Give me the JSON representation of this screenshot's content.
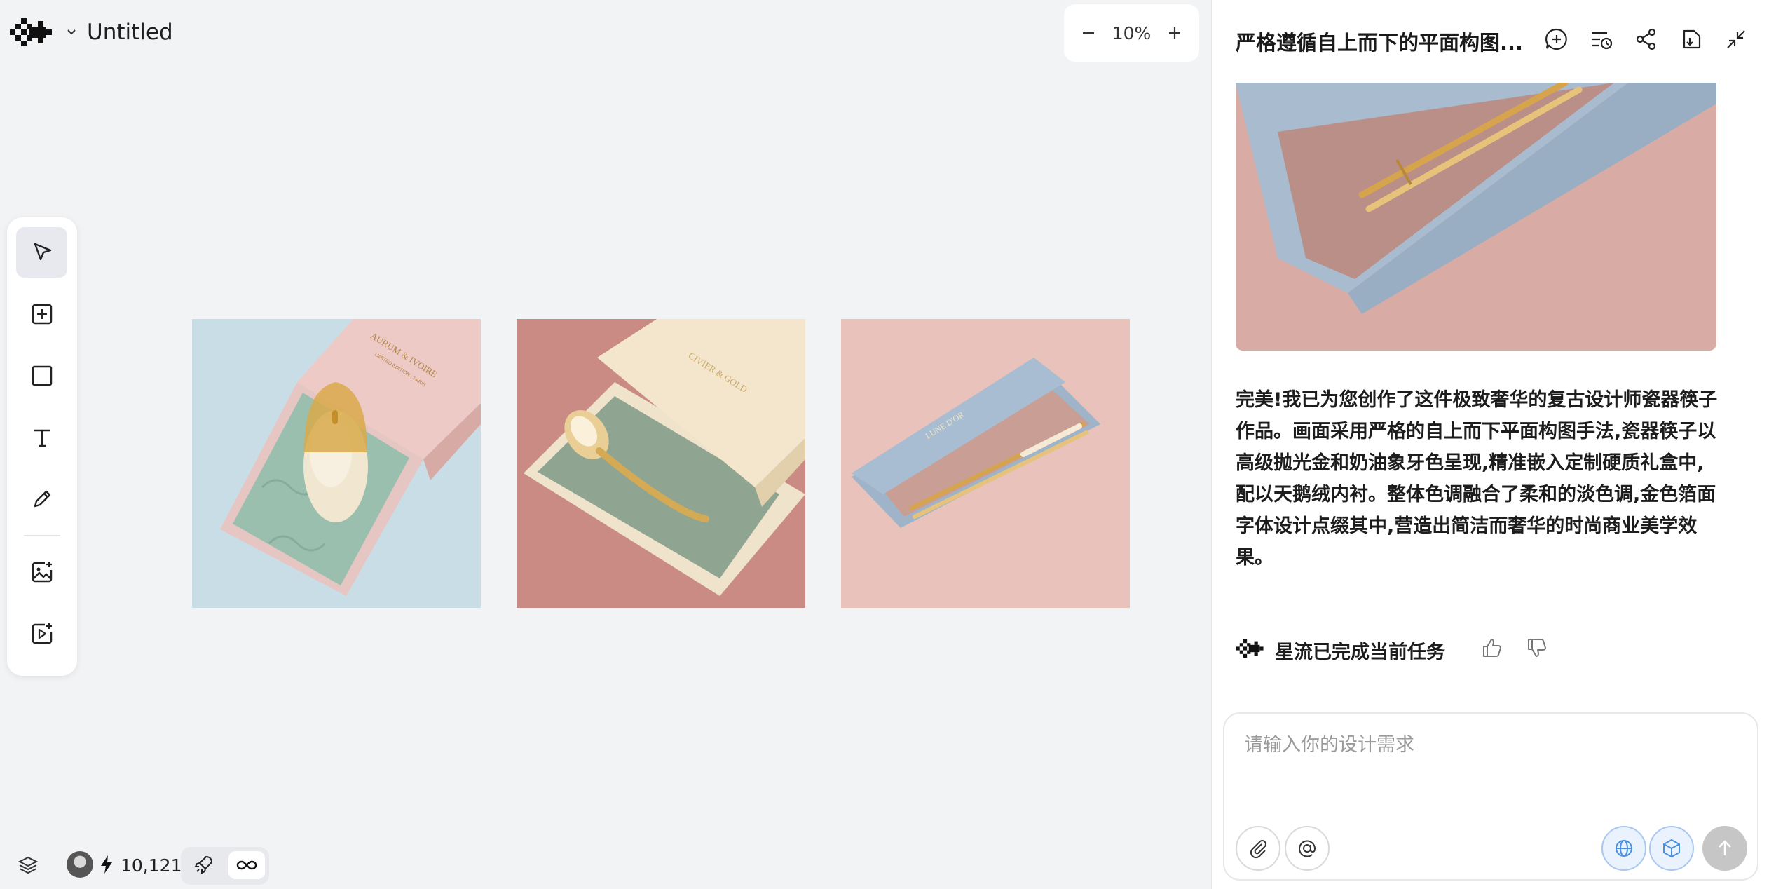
{
  "project": {
    "name": "Untitled"
  },
  "zoom": {
    "level": "10%"
  },
  "toolbar": {
    "tools": [
      "select",
      "add-frame",
      "rectangle",
      "text",
      "pen",
      "generate-image",
      "generate-video"
    ],
    "active": "select"
  },
  "artboards": [
    {
      "product": "mouse",
      "box_text_line1": "AURUM & IVOIRE",
      "box_text_line2": "LIMITED EDITION · PARIS",
      "background": "#c9dde6"
    },
    {
      "product": "spoon",
      "box_text_line1": "CIVIER & GOLD",
      "background": "#c98b83"
    },
    {
      "product": "chopsticks",
      "box_text_line1": "LUNE D'OR",
      "background": "#e8c2bb"
    }
  ],
  "footer": {
    "credits": "10,121"
  },
  "chat": {
    "title": "严格遵循自上而下的平面构图...",
    "message": "完美!我已为您创作了这件极致奢华的复古设计师瓷器筷子作品。画面采用严格的自上而下平面构图手法,瓷器筷子以高级抛光金和奶油象牙色呈现,精准嵌入定制硬质礼盒中,配以天鹅绒内衬。整体色调融合了柔和的淡色调,金色箔面字体设计点缀其中,营造出简洁而奢华的时尚商业美学效果。",
    "status": "星流已完成当前任务",
    "input_placeholder": "请输入你的设计需求"
  },
  "colors": {
    "canvas_bg": "#f2f3f5",
    "accent_blue": "#4a8fe0",
    "send_disabled": "#c6c6c6"
  },
  "icons": {
    "header": [
      "new-chat-icon",
      "history-icon",
      "share-icon",
      "download-icon",
      "collapse-icon"
    ],
    "composer": [
      "paperclip-icon",
      "at-icon",
      "globe-icon",
      "cube-icon",
      "arrow-up-icon"
    ]
  }
}
